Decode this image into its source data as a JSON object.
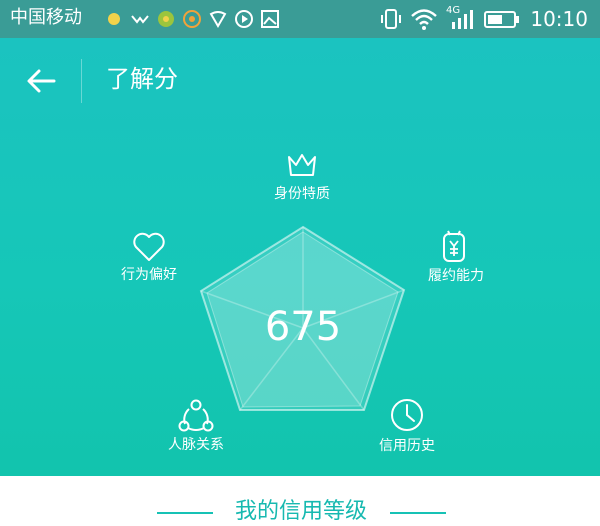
{
  "status_bar": {
    "carrier": "中国移动",
    "network": "4G",
    "time": "10:10",
    "icons": [
      "notification-dot-icon",
      "wechat-icon",
      "game-icon",
      "coin-icon",
      "shield-icon",
      "video-icon",
      "gallery-icon",
      "vibrate-icon",
      "wifi-icon",
      "signal-icon",
      "battery-icon"
    ]
  },
  "header": {
    "back_icon": "back-arrow-icon",
    "title": "了解分"
  },
  "radar": {
    "score": "675",
    "axes": [
      {
        "label": "身份特质",
        "icon": "crown-icon"
      },
      {
        "label": "履约能力",
        "icon": "contract-yuan-icon"
      },
      {
        "label": "信用历史",
        "icon": "clock-icon"
      },
      {
        "label": "人脉关系",
        "icon": "network-icon"
      },
      {
        "label": "行为偏好",
        "icon": "heart-icon"
      }
    ]
  },
  "section": {
    "title": "我的信用等级"
  },
  "colors": {
    "status_bar": "#3a9c96",
    "hero_top": "#1bc3c0",
    "hero_bottom": "#12c4ad",
    "accent": "#17c2b5",
    "text_light": "#ffffff"
  }
}
